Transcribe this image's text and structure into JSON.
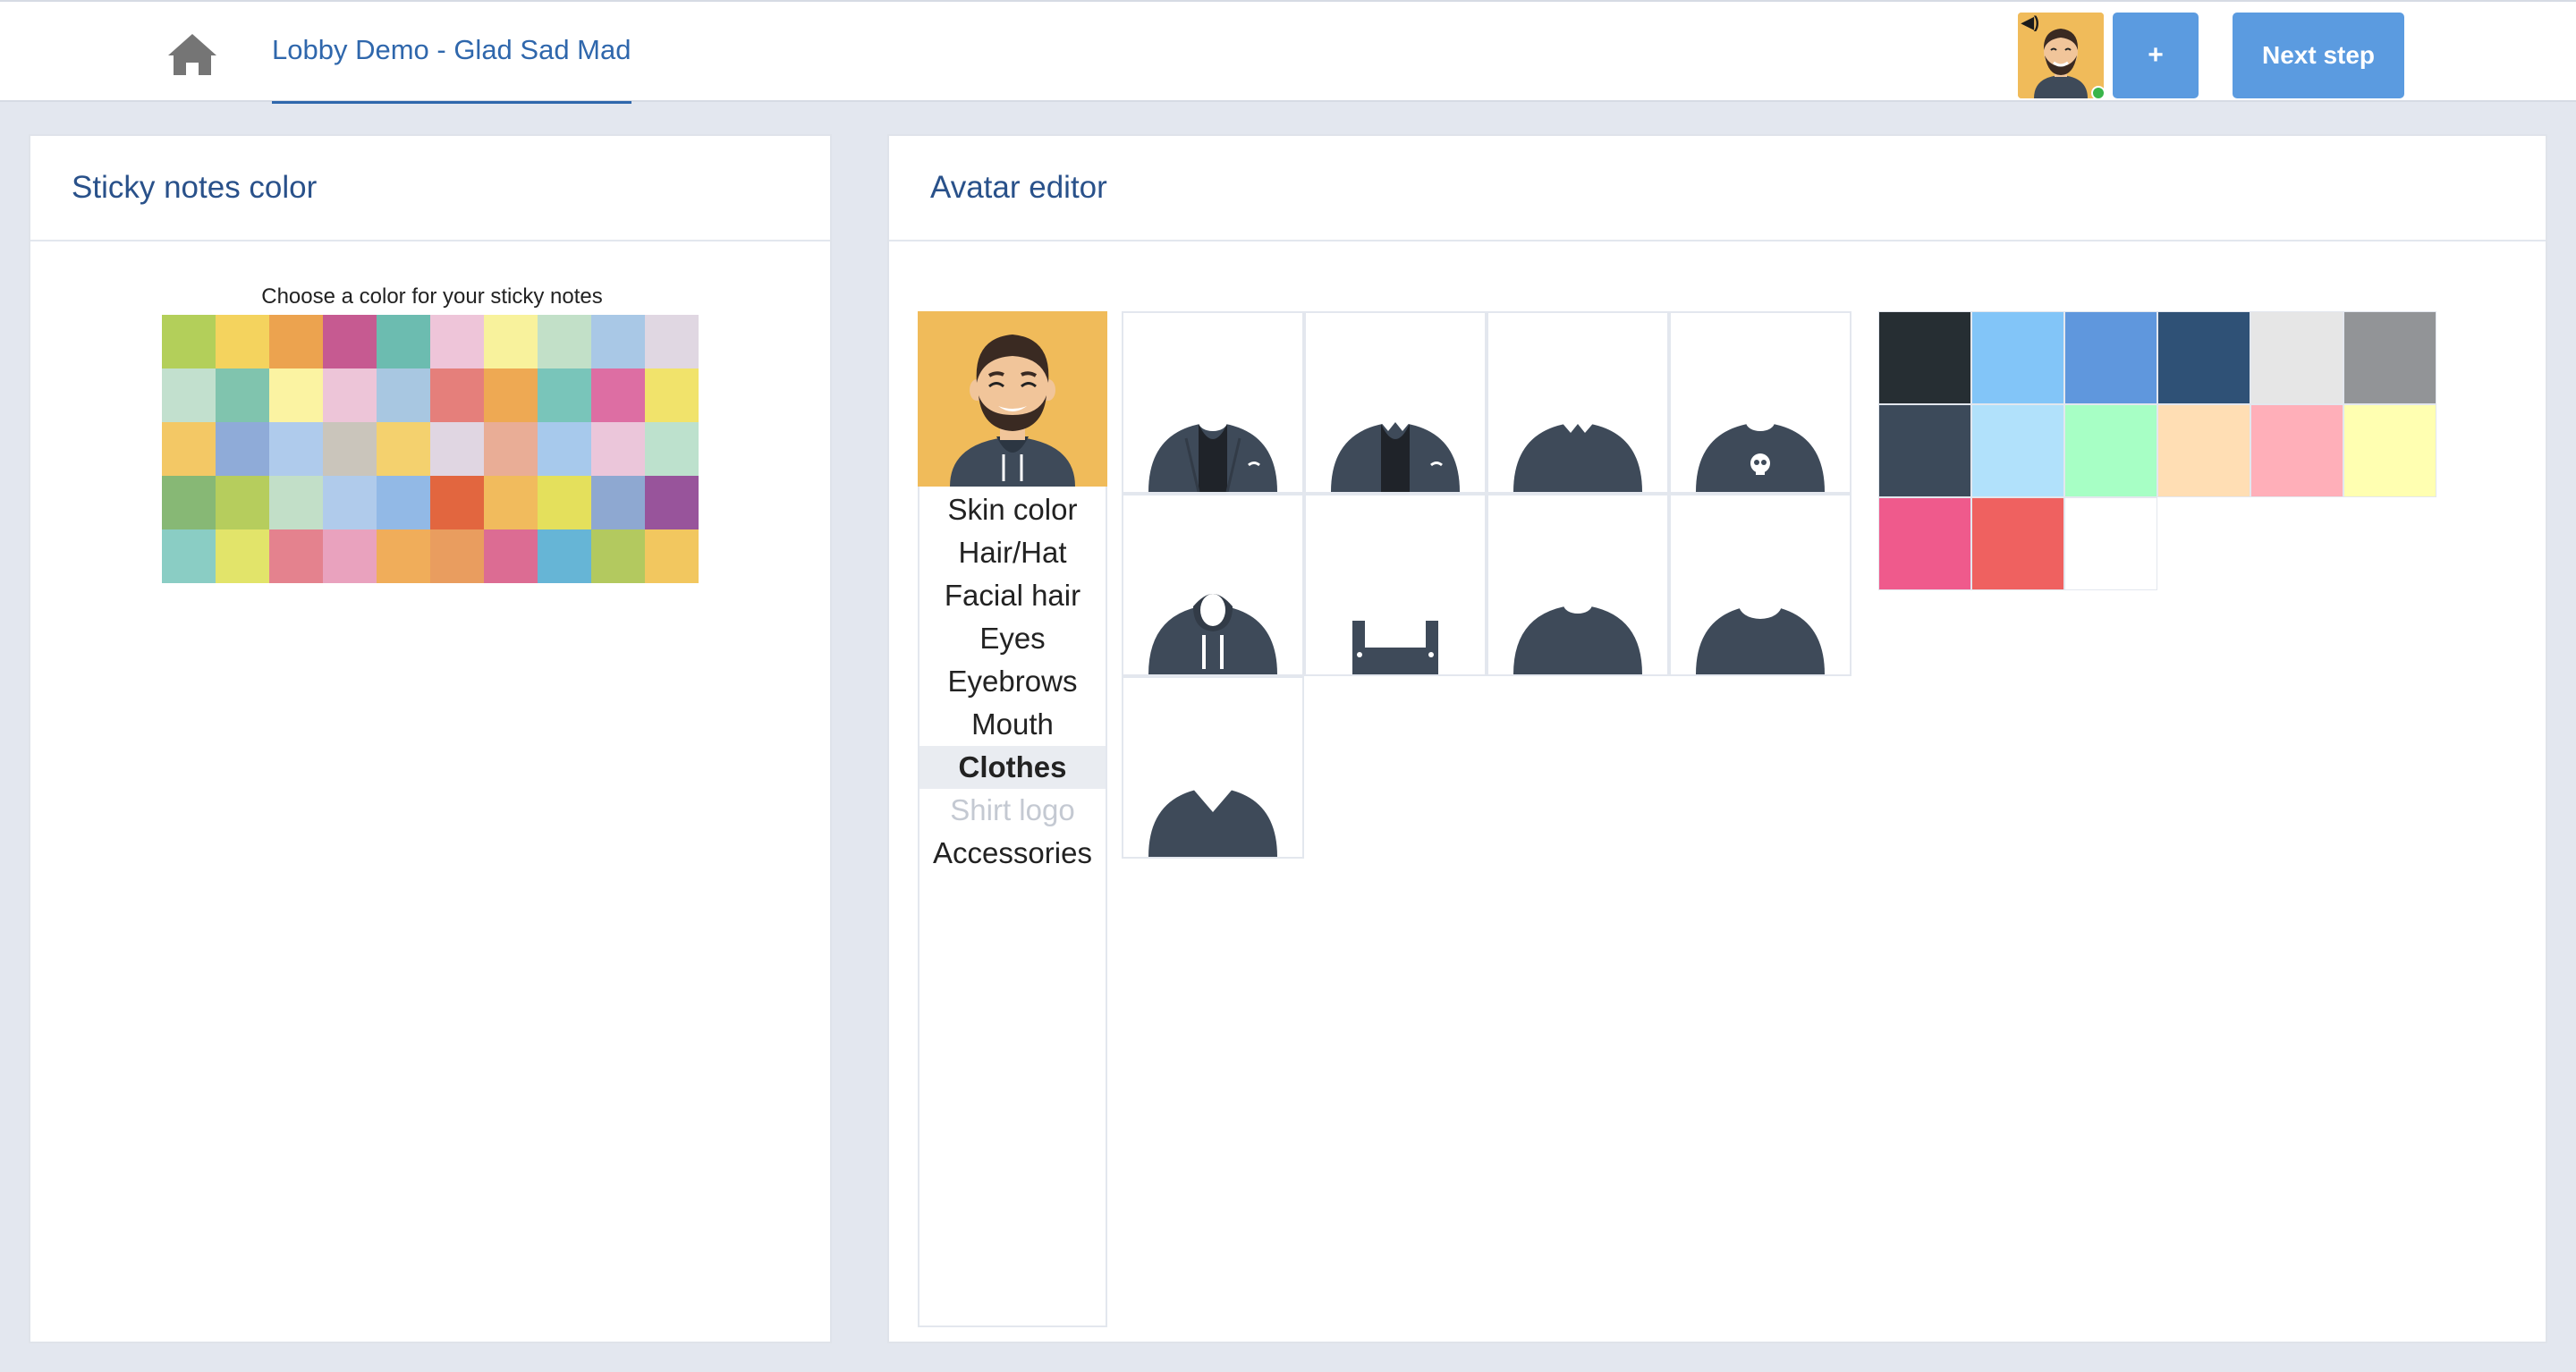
{
  "header": {
    "title": "Lobby Demo - Glad Sad Mad",
    "plus_label": "+",
    "next_label": "Next step",
    "home_icon": "home-icon",
    "avatar_icon": "avatar-icon",
    "online_status_color": "#39b54a",
    "accent_color": "#5b9be0"
  },
  "sticky": {
    "title": "Sticky notes color",
    "caption": "Choose a color for your sticky notes",
    "colors": [
      "#b3cf5a",
      "#f4d35e",
      "#eca34f",
      "#c65a91",
      "#6cbcb0",
      "#eec5d9",
      "#f8f29c",
      "#c2e0c8",
      "#a9c8e6",
      "#e0d7e2",
      "#c2e0ce",
      "#80c4ae",
      "#fbf3a2",
      "#edc5d8",
      "#a8c7e1",
      "#e57f7b",
      "#eea953",
      "#79c5ba",
      "#dd6ea3",
      "#f1e36b",
      "#f3c865",
      "#8fabd8",
      "#afcbec",
      "#cac5bb",
      "#f4d16e",
      "#e0d6e2",
      "#e9ad96",
      "#a7c9ec",
      "#ebc6da",
      "#bde1cd",
      "#87b875",
      "#b6cd5d",
      "#c2dfc8",
      "#b0cbeb",
      "#92b9e6",
      "#e2663f",
      "#f1bb5d",
      "#e4e05c",
      "#8ea8d1",
      "#98549b",
      "#8acdc4",
      "#e2e46a",
      "#e4828e",
      "#e9a2be",
      "#f0ad5a",
      "#e99d5f",
      "#dc6c93",
      "#66b5d6",
      "#b3c95f",
      "#f2c75f"
    ]
  },
  "editor": {
    "title": "Avatar editor",
    "menu": [
      {
        "label": "Skin color",
        "state": "normal"
      },
      {
        "label": "Hair/Hat",
        "state": "normal"
      },
      {
        "label": "Facial hair",
        "state": "normal"
      },
      {
        "label": "Eyes",
        "state": "normal"
      },
      {
        "label": "Eyebrows",
        "state": "normal"
      },
      {
        "label": "Mouth",
        "state": "normal"
      },
      {
        "label": "Clothes",
        "state": "active"
      },
      {
        "label": "Shirt logo",
        "state": "disabled"
      },
      {
        "label": "Accessories",
        "state": "normal"
      }
    ],
    "clothes_options": [
      "blazer-shirt",
      "blazer-sweater",
      "collar-shirt",
      "graphic-shirt",
      "hoodie",
      "overall",
      "crew-neck",
      "scoop-neck",
      "v-neck"
    ],
    "clothes_color": "#3e4a59",
    "preview_background": "#f0bb5a",
    "color_swatches": [
      "#262e33",
      "#82c5f8",
      "#5f97dd",
      "#2f5176",
      "#e6e6e6",
      "#929497",
      "#3c4a5a",
      "#b1e1fb",
      "#a7ffc5",
      "#ffdeb4",
      "#ffafb9",
      "#ffffb1",
      "#ef5a8c",
      "#ef6160",
      "#ffffff"
    ]
  }
}
